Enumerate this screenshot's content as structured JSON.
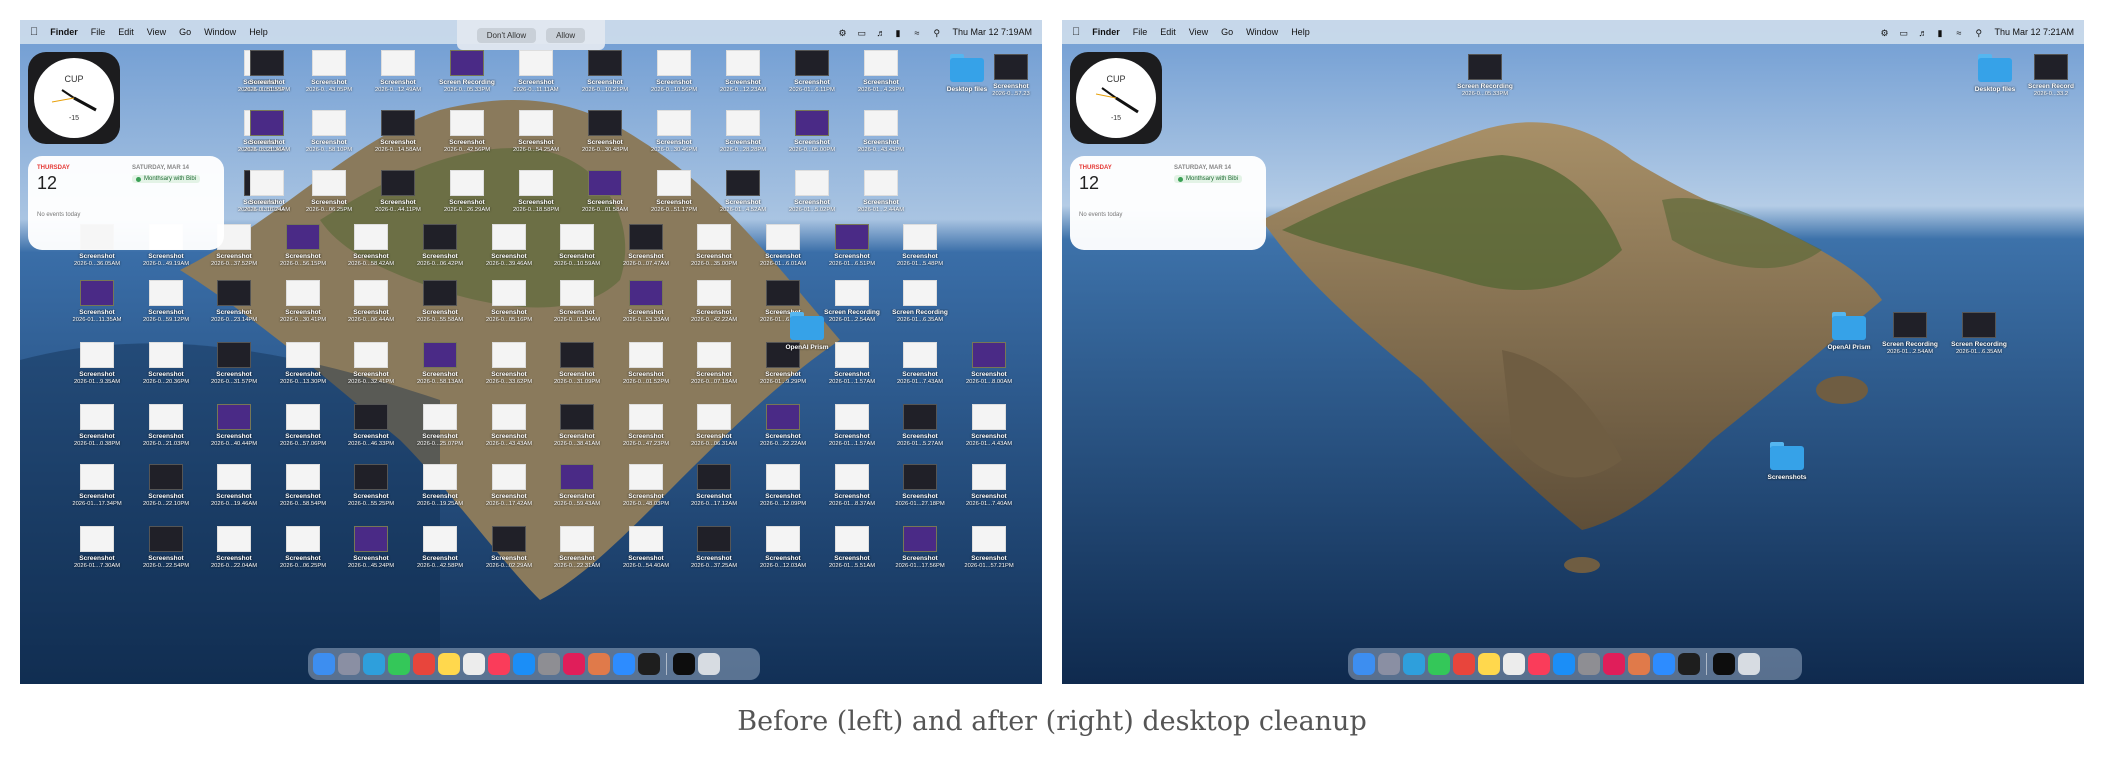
{
  "caption": "Before (left) and after (right) desktop cleanup",
  "menubar": {
    "app_name": "Finder",
    "menus": [
      "File",
      "Edit",
      "View",
      "Go",
      "Window",
      "Help"
    ]
  },
  "before": {
    "datetime": "Thu Mar 12  7:19AM",
    "prompt": {
      "deny_label": "Don't Allow",
      "allow_label": "Allow"
    },
    "clock": {
      "city": "CUP",
      "offset": "-15"
    },
    "calendar": {
      "day": "THURSDAY",
      "date": "12",
      "upcoming_day": "SATURDAY, MAR 14",
      "event": "Monthsary with Bibi",
      "no_events": "No events today"
    },
    "icons": [
      {
        "n": "Screenshot",
        "s": "2026-0...10.01PM"
      },
      {
        "n": "Screenshot",
        "s": "2026-0...51.55PM"
      },
      {
        "n": "Screenshot",
        "s": "2026-0...43.05PM"
      },
      {
        "n": "Screenshot",
        "s": "2026-0...12.49AM"
      },
      {
        "n": "Screen Recording",
        "s": "2026-0...05.33PM"
      },
      {
        "n": "Screenshot",
        "s": "2026-0...11.11AM"
      },
      {
        "n": "Screenshot",
        "s": "2026-0...10.21PM"
      },
      {
        "n": "Screenshot",
        "s": "2026-0...10.56PM"
      },
      {
        "n": "Screenshot",
        "s": "2026-0...12.23AM"
      },
      {
        "n": "Screenshot",
        "s": "2026-01...6.11PM"
      },
      {
        "n": "Screenshot",
        "s": "2026-01...4.29PM"
      },
      {
        "n": "Screenshot",
        "s": "2026-0...33.31AM"
      },
      {
        "n": "Screenshot",
        "s": "2026-0...21.36AM"
      },
      {
        "n": "Screenshot",
        "s": "2026-0...58.10PM"
      },
      {
        "n": "Screenshot",
        "s": "2026-0...14.58AM"
      },
      {
        "n": "Screenshot",
        "s": "2026-0...42.56PM"
      },
      {
        "n": "Screenshot",
        "s": "2026-0...54.25AM"
      },
      {
        "n": "Screenshot",
        "s": "2026-0...30.48PM"
      },
      {
        "n": "Screenshot",
        "s": "2026-0...30.46PM"
      },
      {
        "n": "Screenshot",
        "s": "2026-0...28.28PM"
      },
      {
        "n": "Screenshot",
        "s": "2026-0...05.00PM"
      },
      {
        "n": "Screenshot",
        "s": "2026-0...43.43PM"
      },
      {
        "n": "Screenshot",
        "s": "2026-0...13.19PM"
      },
      {
        "n": "Screenshot",
        "s": "2026-0...16.24AM"
      },
      {
        "n": "Screenshot",
        "s": "2026-0...06.25PM"
      },
      {
        "n": "Screenshot",
        "s": "2026-0...44.11PM"
      },
      {
        "n": "Screenshot",
        "s": "2026-0...26.29AM"
      },
      {
        "n": "Screenshot",
        "s": "2026-0...18.58PM"
      },
      {
        "n": "Screenshot",
        "s": "2026-0...01.58AM"
      },
      {
        "n": "Screenshot",
        "s": "2026-0...51.17PM"
      },
      {
        "n": "Screenshot",
        "s": "2026-01...4.52AM"
      },
      {
        "n": "Screenshot",
        "s": "2026-01...5.02PM"
      },
      {
        "n": "Screenshot",
        "s": "2026-01...2.44AM"
      },
      {
        "n": "Screenshot",
        "s": "2026-0...36.05AM"
      },
      {
        "n": "Screenshot",
        "s": "2026-0...49.19AM"
      },
      {
        "n": "Screenshot",
        "s": "2026-0...37.52PM"
      },
      {
        "n": "Screenshot",
        "s": "2026-0...56.15PM"
      },
      {
        "n": "Screenshot",
        "s": "2026-0...58.42AM"
      },
      {
        "n": "Screenshot",
        "s": "2026-0...06.42PM"
      },
      {
        "n": "Screenshot",
        "s": "2026-0...39.46AM"
      },
      {
        "n": "Screenshot",
        "s": "2026-0...10.59AM"
      },
      {
        "n": "Screenshot",
        "s": "2026-0...07.47AM"
      },
      {
        "n": "Screenshot",
        "s": "2026-0...35.00PM"
      },
      {
        "n": "Screenshot",
        "s": "2026-01...6.01AM"
      },
      {
        "n": "Screenshot",
        "s": "2026-01...6.51PM"
      },
      {
        "n": "Screenshot",
        "s": "2026-01...5.48PM"
      },
      {
        "n": "Screenshot",
        "s": "2026-01...11.35AM"
      },
      {
        "n": "Screenshot",
        "s": "2026-0...59.12PM"
      },
      {
        "n": "Screenshot",
        "s": "2026-0...23.14PM"
      },
      {
        "n": "Screenshot",
        "s": "2026-0...30.41PM"
      },
      {
        "n": "Screenshot",
        "s": "2026-0...06.44AM"
      },
      {
        "n": "Screenshot",
        "s": "2026-0...55.58AM"
      },
      {
        "n": "Screenshot",
        "s": "2026-0...05.16PM"
      },
      {
        "n": "Screenshot",
        "s": "2026-0...01.34AM"
      },
      {
        "n": "Screenshot",
        "s": "2026-0...53.33AM"
      },
      {
        "n": "Screenshot",
        "s": "2026-0...42.22AM"
      },
      {
        "n": "Screenshot",
        "s": "2026-01...6.22PM"
      },
      {
        "n": "Screen Recording",
        "s": "2026-01...2.54AM"
      },
      {
        "n": "Screen Recording",
        "s": "2026-01...6.35AM"
      },
      {
        "n": "Screenshot",
        "s": "2026-01...9.35AM"
      },
      {
        "n": "Screenshot",
        "s": "2026-0...20.36PM"
      },
      {
        "n": "Screenshot",
        "s": "2026-0...31.57PM"
      },
      {
        "n": "Screenshot",
        "s": "2026-0...13.30PM"
      },
      {
        "n": "Screenshot",
        "s": "2026-0...32.41PM"
      },
      {
        "n": "Screenshot",
        "s": "2026-0...58.13AM"
      },
      {
        "n": "Screenshot",
        "s": "2026-0...33.62PM"
      },
      {
        "n": "Screenshot",
        "s": "2026-0...31.09PM"
      },
      {
        "n": "Screenshot",
        "s": "2026-0...01.52PM"
      },
      {
        "n": "Screenshot",
        "s": "2026-0...07.18AM"
      },
      {
        "n": "Screenshot",
        "s": "2026-01...9.29PM"
      },
      {
        "n": "Screenshot",
        "s": "2026-01...1.57AM"
      },
      {
        "n": "Screenshot",
        "s": "2026-01...7.43AM"
      },
      {
        "n": "Screenshot",
        "s": "2026-01...8.00AM"
      },
      {
        "n": "Screenshot",
        "s": "2026-01...0.38PM"
      },
      {
        "n": "Screenshot",
        "s": "2026-0...21.03PM"
      },
      {
        "n": "Screenshot",
        "s": "2026-0...40.44PM"
      },
      {
        "n": "Screenshot",
        "s": "2026-0...57.06PM"
      },
      {
        "n": "Screenshot",
        "s": "2026-0...46.33PM"
      },
      {
        "n": "Screenshot",
        "s": "2026-0...25.07PM"
      },
      {
        "n": "Screenshot",
        "s": "2026-0...43.43AM"
      },
      {
        "n": "Screenshot",
        "s": "2026-0...38.41AM"
      },
      {
        "n": "Screenshot",
        "s": "2026-0...47.23PM"
      },
      {
        "n": "Screenshot",
        "s": "2026-0...06.31AM"
      },
      {
        "n": "Screenshot",
        "s": "2026-0...22.22AM"
      },
      {
        "n": "Screenshot",
        "s": "2026-01...1.57AM"
      },
      {
        "n": "Screenshot",
        "s": "2026-01...5.27AM"
      },
      {
        "n": "Screenshot",
        "s": "2026-01...4.43AM"
      },
      {
        "n": "Screenshot",
        "s": "2026-01...17.34PM"
      },
      {
        "n": "Screenshot",
        "s": "2026-0...22.10PM"
      },
      {
        "n": "Screenshot",
        "s": "2026-0...19.46AM"
      },
      {
        "n": "Screenshot",
        "s": "2026-0...58.54PM"
      },
      {
        "n": "Screenshot",
        "s": "2026-0...55.25PM"
      },
      {
        "n": "Screenshot",
        "s": "2026-0...19.25AM"
      },
      {
        "n": "Screenshot",
        "s": "2026-0...17.42AM"
      },
      {
        "n": "Screenshot",
        "s": "2026-0...59.43AM"
      },
      {
        "n": "Screenshot",
        "s": "2026-0...48.03PM"
      },
      {
        "n": "Screenshot",
        "s": "2026-0...17.12AM"
      },
      {
        "n": "Screenshot",
        "s": "2026-0...12.09PM"
      },
      {
        "n": "Screenshot",
        "s": "2026-01...8.37AM"
      },
      {
        "n": "Screenshot",
        "s": "2026-01...27.18PM"
      },
      {
        "n": "Screenshot",
        "s": "2026-01...7.40AM"
      },
      {
        "n": "Screenshot",
        "s": "2026-01...7.30AM"
      },
      {
        "n": "Screenshot",
        "s": "2026-0...22.54PM"
      },
      {
        "n": "Screenshot",
        "s": "2026-0...22.04AM"
      },
      {
        "n": "Screenshot",
        "s": "2026-0...06.25PM"
      },
      {
        "n": "Screenshot",
        "s": "2026-0...45.24PM"
      },
      {
        "n": "Screenshot",
        "s": "2026-0...42.58PM"
      },
      {
        "n": "Screenshot",
        "s": "2026-0...02.29AM"
      },
      {
        "n": "Screenshot",
        "s": "2026-0...22.31AM"
      },
      {
        "n": "Screenshot",
        "s": "2026-0...54.40AM"
      },
      {
        "n": "Screenshot",
        "s": "2026-0...37.25AM"
      },
      {
        "n": "Screenshot",
        "s": "2026-0...12.03AM"
      },
      {
        "n": "Screenshot",
        "s": "2026-01...5.51AM"
      },
      {
        "n": "Screenshot",
        "s": "2026-01...17.56PM"
      },
      {
        "n": "Screenshot",
        "s": "2026-01...57.21PM"
      },
      {
        "n": "Screenshot",
        "s": "2026-01...8.04AM"
      }
    ],
    "folders": [
      {
        "n": "Desktop files",
        "s": ""
      },
      {
        "n": "OpenAI Prism",
        "s": ""
      }
    ],
    "corner_item": {
      "n": "Screenshot",
      "s": "2026-0...57.23"
    }
  },
  "after": {
    "datetime": "Thu Mar 12  7:21AM",
    "clock": {
      "city": "CUP",
      "offset": "-15"
    },
    "calendar": {
      "day": "THURSDAY",
      "date": "12",
      "upcoming_day": "SATURDAY, MAR 14",
      "event": "Monthsary with Bibi",
      "no_events": "No events today"
    },
    "items": [
      {
        "n": "Screen Recording",
        "s": "2026-0...05.33PM"
      },
      {
        "n": "Desktop files",
        "s": ""
      },
      {
        "n": "Screen Record",
        "s": "2026-0...33.2"
      },
      {
        "n": "OpenAI Prism",
        "s": ""
      },
      {
        "n": "Screen Recording",
        "s": "2026-01...2.54AM"
      },
      {
        "n": "Screen Recording",
        "s": "2026-01...6.35AM"
      },
      {
        "n": "Screenshots",
        "s": ""
      }
    ]
  },
  "dock": {
    "apps": [
      "finder-icon",
      "launchpad-icon",
      "telegram-icon",
      "facetime-icon",
      "chrome-icon",
      "notes-icon",
      "chatgpt-icon",
      "music-icon",
      "app-store-icon",
      "settings-icon",
      "slack-icon",
      "claude-icon",
      "zoom-icon",
      "terminal-icon",
      "figma-icon"
    ],
    "colors": [
      "#3d8ef0",
      "#8a8fa3",
      "#2e9fdc",
      "#34c759",
      "#e8453c",
      "#ffd84d",
      "#ececec",
      "#fa3c5a",
      "#1b8ef7",
      "#8e8e93",
      "#e01e5a",
      "#e07a4a",
      "#2d8cff",
      "#1e1e1e",
      "#0d0d0d"
    ]
  }
}
